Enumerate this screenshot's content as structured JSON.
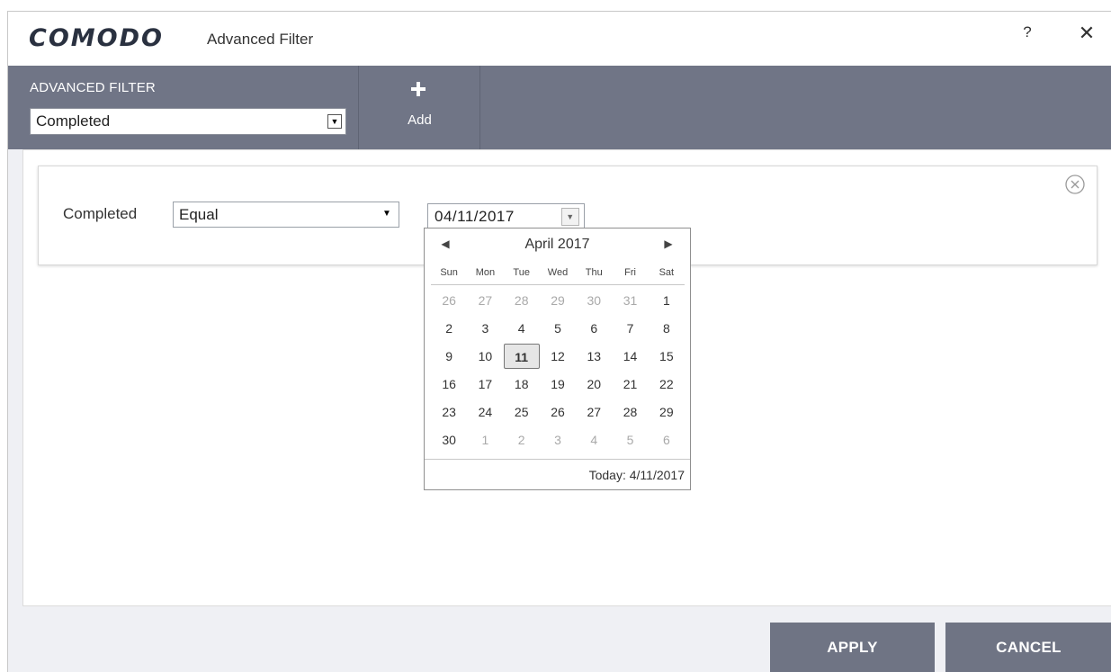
{
  "window": {
    "brand": "COMODO",
    "title": "Advanced Filter",
    "help_label": "?",
    "close_label": "✕"
  },
  "toolbar": {
    "filter_caption": "ADVANCED FILTER",
    "filter_selected": "Completed",
    "add_label": "Add"
  },
  "filter_row": {
    "field_label": "Completed",
    "operator": "Equal",
    "date_value": "04/11/2017"
  },
  "calendar": {
    "month_title": "April 2017",
    "weekdays": [
      "Sun",
      "Mon",
      "Tue",
      "Wed",
      "Thu",
      "Fri",
      "Sat"
    ],
    "days": [
      {
        "d": "26",
        "m": true
      },
      {
        "d": "27",
        "m": true
      },
      {
        "d": "28",
        "m": true
      },
      {
        "d": "29",
        "m": true
      },
      {
        "d": "30",
        "m": true
      },
      {
        "d": "31",
        "m": true
      },
      {
        "d": "1",
        "m": false
      },
      {
        "d": "2",
        "m": false
      },
      {
        "d": "3",
        "m": false
      },
      {
        "d": "4",
        "m": false
      },
      {
        "d": "5",
        "m": false
      },
      {
        "d": "6",
        "m": false
      },
      {
        "d": "7",
        "m": false
      },
      {
        "d": "8",
        "m": false
      },
      {
        "d": "9",
        "m": false
      },
      {
        "d": "10",
        "m": false
      },
      {
        "d": "11",
        "m": false,
        "selected": true
      },
      {
        "d": "12",
        "m": false
      },
      {
        "d": "13",
        "m": false
      },
      {
        "d": "14",
        "m": false
      },
      {
        "d": "15",
        "m": false
      },
      {
        "d": "16",
        "m": false
      },
      {
        "d": "17",
        "m": false
      },
      {
        "d": "18",
        "m": false
      },
      {
        "d": "19",
        "m": false
      },
      {
        "d": "20",
        "m": false
      },
      {
        "d": "21",
        "m": false
      },
      {
        "d": "22",
        "m": false
      },
      {
        "d": "23",
        "m": false
      },
      {
        "d": "24",
        "m": false
      },
      {
        "d": "25",
        "m": false
      },
      {
        "d": "26",
        "m": false
      },
      {
        "d": "27",
        "m": false
      },
      {
        "d": "28",
        "m": false
      },
      {
        "d": "29",
        "m": false
      },
      {
        "d": "30",
        "m": false
      },
      {
        "d": "1",
        "m": true
      },
      {
        "d": "2",
        "m": true
      },
      {
        "d": "3",
        "m": true
      },
      {
        "d": "4",
        "m": true
      },
      {
        "d": "5",
        "m": true
      },
      {
        "d": "6",
        "m": true
      }
    ],
    "today_label": "Today: 4/11/2017"
  },
  "buttons": {
    "apply": "APPLY",
    "cancel": "CANCEL"
  },
  "colors": {
    "toolbar_bg": "#707586",
    "button_bg": "#6f7484",
    "window_bg": "#eff0f4"
  },
  "icons": {
    "prev": "triangle-left-icon",
    "next": "triangle-right-icon",
    "add": "plus-icon",
    "remove": "circle-x-icon",
    "dropdown": "chevron-down-icon"
  }
}
